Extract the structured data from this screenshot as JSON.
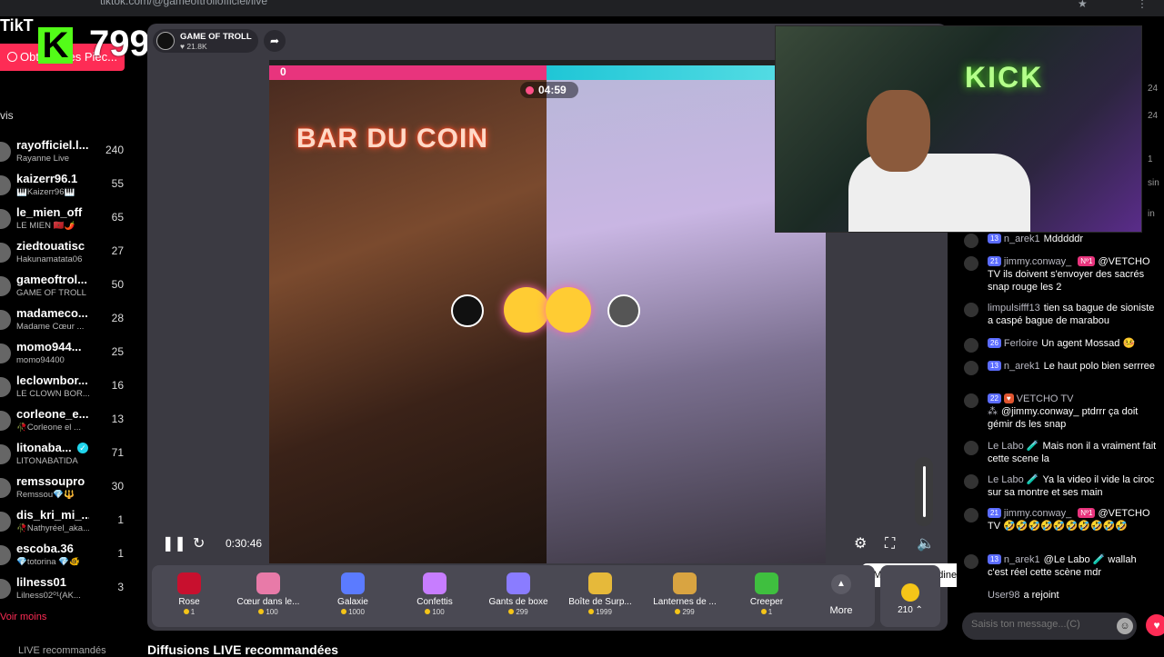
{
  "browser": {
    "url": "tiktok.com/@gameoftrollofficiel/live"
  },
  "sidebar": {
    "logo": "TikT",
    "get_coins": "Obtenir des Pièc...",
    "section": "vis",
    "see_less": "Voir moins",
    "live_cut": "LIVE recommandés",
    "items": [
      {
        "name": "rayofficiel.l...",
        "sub": "Rayanne Live",
        "count": "240"
      },
      {
        "name": "kaizerr96.1",
        "sub": "🎹Kaizerr96🎹",
        "count": "55"
      },
      {
        "name": "le_mien_off",
        "sub": "LE MIEN 🇲🇦🌶️",
        "count": "65"
      },
      {
        "name": "ziedtouatisc",
        "sub": "Hakunamatata06",
        "count": "27"
      },
      {
        "name": "gameoftrol...",
        "sub": "GAME OF TROLL",
        "count": "50"
      },
      {
        "name": "madameco...",
        "sub": "Madame Cœur ...",
        "count": "28"
      },
      {
        "name": "momo944...",
        "sub": "momo94400",
        "count": "25"
      },
      {
        "name": "leclownbor...",
        "sub": "LE CLOWN BOR...",
        "count": "16"
      },
      {
        "name": "corleone_e...",
        "sub": "🥀Corleone el ...",
        "count": "13"
      },
      {
        "name": "litonaba...",
        "sub": "LITONABATIDA",
        "count": "71"
      },
      {
        "name": "remssoupro",
        "sub": "Remssou💎🔱",
        "count": "30"
      },
      {
        "name": "dis_kri_mi_...",
        "sub": "🥀Nathyréel_aka...",
        "count": "1"
      },
      {
        "name": "escoba.36",
        "sub": "💎totorina 💎🐠",
        "count": "1"
      },
      {
        "name": "lilness01",
        "sub": "Lilness02⁰¹(AK...",
        "count": "3"
      }
    ]
  },
  "kick_overlay": {
    "letter": "K",
    "count": "799"
  },
  "host": {
    "name": "GAME OF TROLL",
    "likes": "♥ 21.8K"
  },
  "battle": {
    "sign": "BAR DU COIN",
    "score_left": "0",
    "timer": "04:59",
    "elapsed": "0:30:46",
    "tooltip": "Mettre en sourdine (M)"
  },
  "gifts": [
    {
      "name": "Rose",
      "price": "1",
      "color": "#c8102e"
    },
    {
      "name": "Cœur dans le...",
      "price": "100",
      "color": "#e87aa8"
    },
    {
      "name": "Galaxie",
      "price": "1000",
      "color": "#5b7bff"
    },
    {
      "name": "Confettis",
      "price": "100",
      "color": "#c77dff"
    },
    {
      "name": "Gants de boxe",
      "price": "299",
      "color": "#8a7cff"
    },
    {
      "name": "Boîte de Surp...",
      "price": "1999",
      "color": "#e6b93a"
    },
    {
      "name": "Lanternes de ...",
      "price": "299",
      "color": "#d9a441"
    },
    {
      "name": "Creeper",
      "price": "1",
      "color": "#3fbf3f"
    }
  ],
  "gift_bar": {
    "more": "More",
    "coins": "210 ⌃"
  },
  "recommended_title": "Diffusions LIVE recommandées",
  "webcam": {
    "neon": "KICK"
  },
  "chat": {
    "messages": [
      {
        "level": "13",
        "user": "n_arek1",
        "badge": "",
        "mod": "",
        "text": "Mdddddr"
      },
      {
        "level": "21",
        "user": "jimmy.conway_",
        "badge": "Nº1",
        "mod": "",
        "text": "@VETCHO TV ils doivent s'envoyer des sacrés snap rouge les 2"
      },
      {
        "level": "",
        "user": "limpulsifff13",
        "badge": "",
        "mod": "",
        "text": "tien sa bague de sioniste a caspé bague de marabou"
      },
      {
        "level": "26",
        "user": "Ferloire",
        "badge": "",
        "mod": "",
        "text": "Un agent Mossad 🤒"
      },
      {
        "level": "13",
        "user": "n_arek1",
        "badge": "",
        "mod": "",
        "text": "Le haut polo bien serrree"
      },
      {
        "level": "22",
        "user": "VETCHO TV ⁂",
        "badge": "",
        "mod": "♥",
        "text": "@jimmy.conway_ ptdrrr ça doit gémir ds les snap"
      },
      {
        "level": "",
        "user": "Le Labo 🧪",
        "badge": "",
        "mod": "",
        "text": "Mais non il a vraiment fait cette scene la"
      },
      {
        "level": "",
        "user": "Le Labo 🧪",
        "badge": "",
        "mod": "",
        "text": "Ya la video il vide la ciroc sur sa montre et ses main"
      },
      {
        "level": "21",
        "user": "jimmy.conway_",
        "badge": "Nº1",
        "mod": "",
        "text": "@VETCHO TV 🤣🤣🤣🤣🤣🤣🤣🤣🤣🤣"
      },
      {
        "level": "13",
        "user": "n_arek1",
        "badge": "",
        "mod": "",
        "text": "@Le Labo 🧪 wallah c'est réel cette scène mdr"
      }
    ],
    "joined_user": "User98",
    "joined_text": "a rejoint",
    "input_placeholder": "Saisis ton message...(C)",
    "edge": [
      "sin",
      "24",
      "24",
      "1",
      "in"
    ]
  }
}
